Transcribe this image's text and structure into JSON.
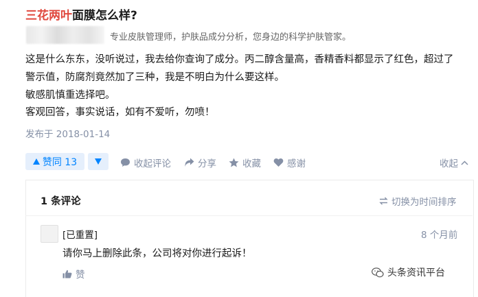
{
  "question": {
    "title_highlight": "三花两叶",
    "title_rest": "面膜怎么样?"
  },
  "author": {
    "bio": "专业皮肤管理师，护肤品成分分析，您身边的科学护肤管家。"
  },
  "answer": {
    "lines": [
      "这是什么东东，没听说过，我去给你查询了成分。丙二醇含量高，香精香料都显示了红色，超过了",
      "警示值，防腐剂竟然加了三种，我是不明白为什么要这样。",
      "敏感肌慎重选择吧。",
      "客观回答，事实说话，如有不爱听，勿喷！"
    ],
    "published": "发布于 2018-01-14"
  },
  "actions": {
    "vote_label": "赞同 13",
    "comment_label": "收起评论",
    "share_label": "分享",
    "favorite_label": "收藏",
    "thanks_label": "感谢",
    "collapse_label": "收起"
  },
  "comments": {
    "count_label": "1 条评论",
    "sort_label": "切换为时间排序",
    "items": [
      {
        "author": "[已重置]",
        "time": "8 个月前",
        "content": "请你马上删除此条，公司将对你进行起诉！",
        "like_label": "赞"
      }
    ]
  },
  "watermark": {
    "text": "头条资讯平台"
  },
  "colors": {
    "accent": "#0084ff",
    "title_highlight": "#e0483e",
    "muted": "#8590a6"
  }
}
